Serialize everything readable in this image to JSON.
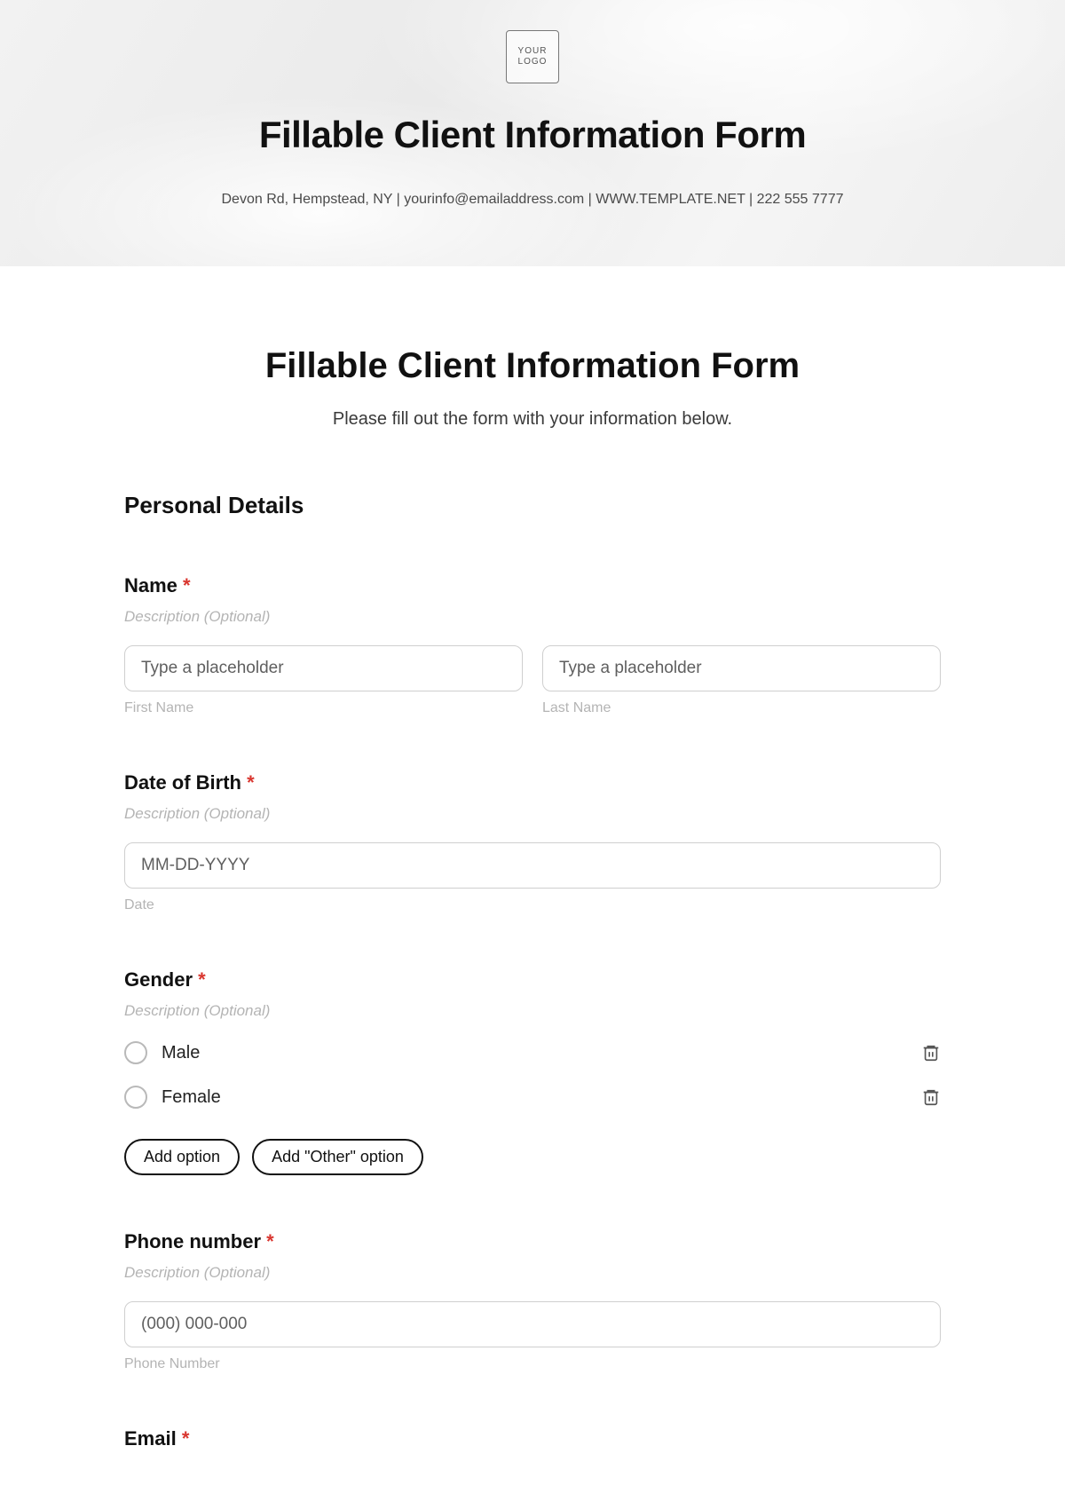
{
  "hero": {
    "logo_text": "YOUR\nLOGO",
    "title": "Fillable Client Information Form",
    "subline": "Devon Rd, Hempstead, NY | yourinfo@emailaddress.com | WWW.TEMPLATE.NET | 222 555 7777"
  },
  "page": {
    "title": "Fillable Client Information Form",
    "subtitle": "Please fill out the form with your information below.",
    "section_personal": "Personal Details"
  },
  "name": {
    "label": "Name",
    "required_mark": "*",
    "desc": "Description (Optional)",
    "first_placeholder": "Type a placeholder",
    "first_sub": "First Name",
    "last_placeholder": "Type a placeholder",
    "last_sub": "Last Name"
  },
  "dob": {
    "label": "Date of Birth",
    "required_mark": "*",
    "desc": "Description (Optional)",
    "placeholder": "MM-DD-YYYY",
    "sub": "Date"
  },
  "gender": {
    "label": "Gender",
    "required_mark": "*",
    "desc": "Description (Optional)",
    "options": [
      "Male",
      "Female"
    ],
    "add_option": "Add option",
    "add_other": "Add \"Other\" option"
  },
  "phone": {
    "label": "Phone number",
    "required_mark": "*",
    "desc": "Description (Optional)",
    "placeholder": "(000) 000-000",
    "sub": "Phone Number"
  },
  "email": {
    "label": "Email",
    "required_mark": "*"
  }
}
